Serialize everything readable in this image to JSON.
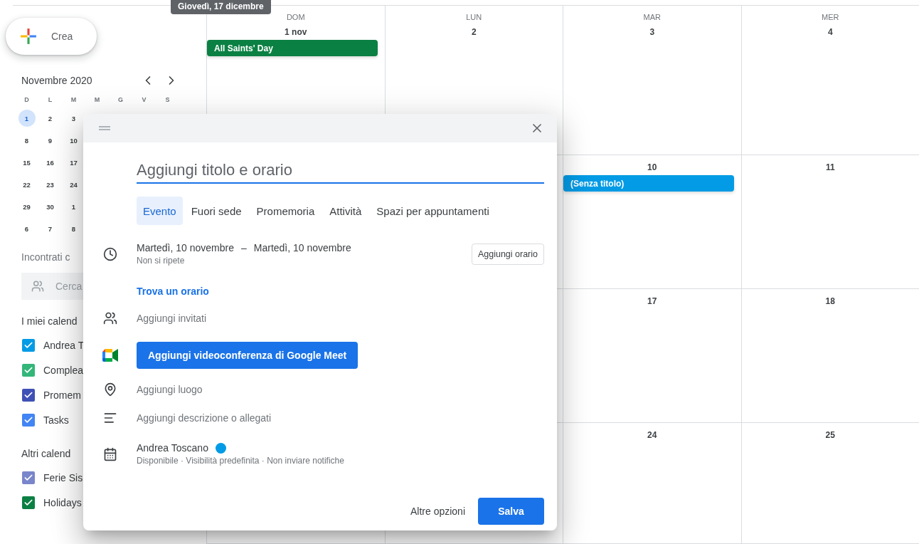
{
  "tooltip": "Giovedì, 17 dicembre",
  "create_button": {
    "label": "Crea"
  },
  "mini_calendar": {
    "title": "Novembre 2020",
    "weekdays": [
      "D",
      "L",
      "M",
      "M",
      "G",
      "V",
      "S"
    ],
    "weeks": [
      [
        {
          "label": "1",
          "selected": true
        },
        {
          "label": "2",
          "selected": false
        },
        {
          "label": "3",
          "selected": false
        }
      ],
      [
        {
          "label": "8",
          "selected": false
        },
        {
          "label": "9",
          "selected": false
        },
        {
          "label": "10",
          "selected": false
        }
      ],
      [
        {
          "label": "15",
          "selected": false
        },
        {
          "label": "16",
          "selected": false
        },
        {
          "label": "17",
          "selected": false
        }
      ],
      [
        {
          "label": "22",
          "selected": false
        },
        {
          "label": "23",
          "selected": false
        },
        {
          "label": "24",
          "selected": false
        }
      ],
      [
        {
          "label": "29",
          "selected": false
        },
        {
          "label": "30",
          "selected": false
        },
        {
          "label": "1",
          "selected": false
        }
      ],
      [
        {
          "label": "6",
          "selected": false
        },
        {
          "label": "7",
          "selected": false
        },
        {
          "label": "8",
          "selected": false
        }
      ]
    ]
  },
  "meet_with": {
    "title": "Incontrati c",
    "search_placeholder": "Cerca"
  },
  "calendar_groups": [
    {
      "title": "I miei calend",
      "items": [
        {
          "label": "Andrea T",
          "checked": true,
          "color": "#039be5"
        },
        {
          "label": "Complea",
          "checked": true,
          "color": "#33b679"
        },
        {
          "label": "Promem",
          "checked": true,
          "color": "#3f51b5"
        },
        {
          "label": "Tasks",
          "checked": true,
          "color": "#4285f4"
        }
      ]
    },
    {
      "title": "Altri calend",
      "items": [
        {
          "label": "Ferie Sis",
          "checked": true,
          "color": "#7986cb"
        },
        {
          "label": "Holidays",
          "checked": true,
          "color": "#0b8043"
        }
      ]
    }
  ],
  "grid": {
    "rows": [
      {
        "cells": [
          {
            "weekday": "DOM",
            "date": "1 nov",
            "events": [
              {
                "title": "All Saints' Day",
                "color": "#0b8043"
              }
            ]
          },
          {
            "weekday": "LUN",
            "date": "2"
          },
          {
            "weekday": "MAR",
            "date": "3"
          },
          {
            "weekday": "MER",
            "date": "4"
          }
        ]
      },
      {
        "cells": [
          {},
          {},
          {
            "date": "10",
            "events": [
              {
                "title": "(Senza titolo)",
                "color": "#039be5"
              }
            ]
          },
          {
            "date": "11"
          }
        ]
      },
      {
        "cells": [
          {},
          {},
          {
            "date": "17"
          },
          {
            "date": "18"
          }
        ]
      },
      {
        "cells": [
          {},
          {},
          {
            "date": "24"
          },
          {
            "date": "25"
          }
        ]
      }
    ]
  },
  "dialog": {
    "title_placeholder": "Aggiungi titolo e orario",
    "tabs": [
      {
        "label": "Evento",
        "selected": true
      },
      {
        "label": "Fuori sede",
        "selected": false
      },
      {
        "label": "Promemoria",
        "selected": false
      },
      {
        "label": "Attività",
        "selected": false
      },
      {
        "label": "Spazi per appuntamenti",
        "selected": false
      }
    ],
    "date_start": "Martedì, 10 novembre",
    "date_separator": "–",
    "date_end": "Martedì, 10 novembre",
    "recurrence": "Non si ripete",
    "add_time_button": "Aggiungi orario",
    "find_time_link": "Trova un orario",
    "guests": "Aggiungi invitati",
    "meet_button": "Aggiungi videoconferenza di Google Meet",
    "location": "Aggiungi luogo",
    "description": "Aggiungi descrizione o allegati",
    "owner": {
      "name": "Andrea Toscano",
      "color": "#039be5"
    },
    "owner_details": "Disponibile · Visibilità predefinita · Non inviare notifiche",
    "more_options": "Altre opzioni",
    "save": "Salva"
  }
}
